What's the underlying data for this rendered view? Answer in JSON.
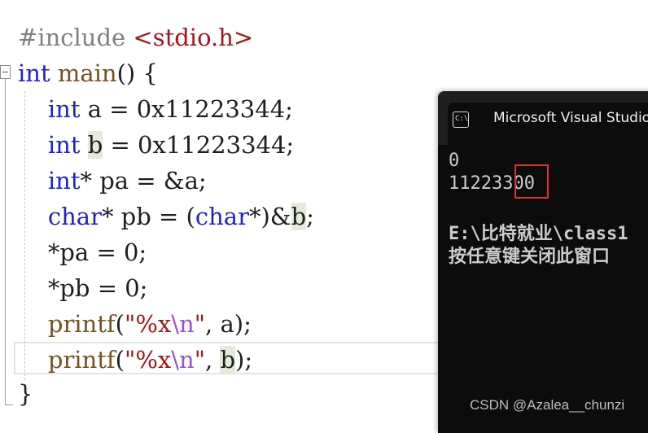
{
  "editor": {
    "lines": [
      {
        "parts": [
          {
            "t": "#include ",
            "c": "pp"
          },
          {
            "t": "<stdio.h>",
            "c": "inc"
          }
        ]
      },
      {
        "parts": [
          {
            "t": "int",
            "c": "kw"
          },
          {
            "t": " ",
            "c": ""
          },
          {
            "t": "main",
            "c": "fn"
          },
          {
            "t": "() {",
            "c": ""
          }
        ]
      },
      {
        "parts": [
          {
            "t": "    ",
            "c": ""
          },
          {
            "t": "int",
            "c": "kw"
          },
          {
            "t": " a = 0x11223344;",
            "c": ""
          }
        ]
      },
      {
        "parts": [
          {
            "t": "    ",
            "c": ""
          },
          {
            "t": "int",
            "c": "kw"
          },
          {
            "t": " ",
            "c": ""
          },
          {
            "t": "b",
            "c": "ref-hl"
          },
          {
            "t": " = 0x11223344;",
            "c": ""
          }
        ]
      },
      {
        "parts": [
          {
            "t": "    ",
            "c": ""
          },
          {
            "t": "int",
            "c": "kw"
          },
          {
            "t": "* pa = &a;",
            "c": ""
          }
        ]
      },
      {
        "parts": [
          {
            "t": "    ",
            "c": ""
          },
          {
            "t": "char",
            "c": "kw"
          },
          {
            "t": "* pb = (",
            "c": ""
          },
          {
            "t": "char",
            "c": "kw"
          },
          {
            "t": "*)&",
            "c": ""
          },
          {
            "t": "b",
            "c": "ref-hl"
          },
          {
            "t": ";",
            "c": ""
          }
        ]
      },
      {
        "parts": [
          {
            "t": "    *pa = 0;",
            "c": ""
          }
        ]
      },
      {
        "parts": [
          {
            "t": "    *pb = 0;",
            "c": ""
          }
        ]
      },
      {
        "parts": [
          {
            "t": "    ",
            "c": ""
          },
          {
            "t": "printf",
            "c": "fn"
          },
          {
            "t": "(",
            "c": ""
          },
          {
            "t": "\"%x",
            "c": "str"
          },
          {
            "t": "\\n",
            "c": "esc"
          },
          {
            "t": "\"",
            "c": "str"
          },
          {
            "t": ", a);",
            "c": ""
          }
        ]
      },
      {
        "parts": [
          {
            "t": "    ",
            "c": ""
          },
          {
            "t": "printf",
            "c": "fn"
          },
          {
            "t": "(",
            "c": ""
          },
          {
            "t": "\"%x",
            "c": "str"
          },
          {
            "t": "\\n",
            "c": "esc"
          },
          {
            "t": "\"",
            "c": "str"
          },
          {
            "t": ", ",
            "c": ""
          },
          {
            "t": "b",
            "c": "ref-hl"
          },
          {
            "t": ");",
            "c": ""
          }
        ]
      },
      {
        "parts": [
          {
            "t": "}",
            "c": ""
          }
        ]
      }
    ]
  },
  "console": {
    "title": "Microsoft Visual Studio",
    "icon": "cmd-icon",
    "output": [
      "0",
      "11223300",
      "",
      "E:\\比特就业\\class1",
      "按任意键关闭此窗口"
    ]
  },
  "watermark": "CSDN @Azalea__chunzi"
}
